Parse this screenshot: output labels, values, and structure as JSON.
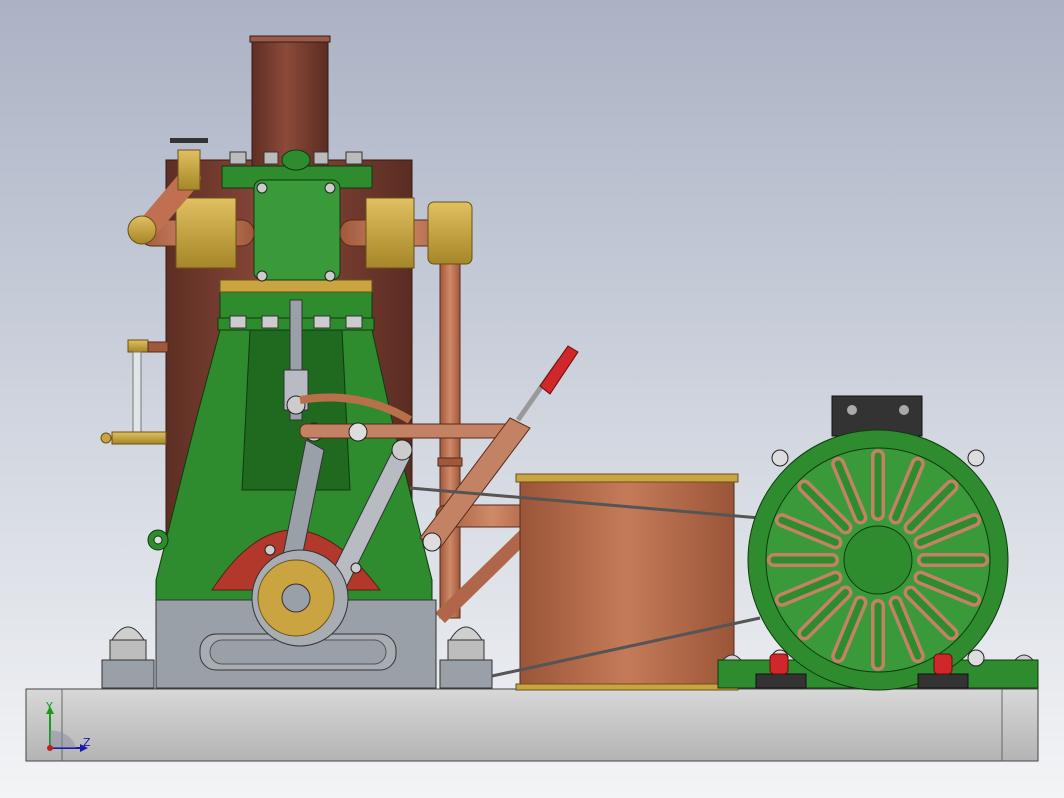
{
  "viewport": {
    "background_top": "#aab2c4",
    "background_bottom": "#f3f4f6"
  },
  "model": {
    "colors": {
      "frame_green": "#2e8b2e",
      "copper": "#b86a4a",
      "brass": "#c9a441",
      "chimney_brown": "#7a4032",
      "base_plate": "#c8c8c8",
      "steel": "#9aa0a8",
      "handle_red": "#d0282a"
    }
  },
  "triad": {
    "y_axis_label": "Y",
    "z_axis_label": "Z",
    "y_axis_color": "#1a9a1a",
    "z_axis_color": "#1a1aaa"
  }
}
